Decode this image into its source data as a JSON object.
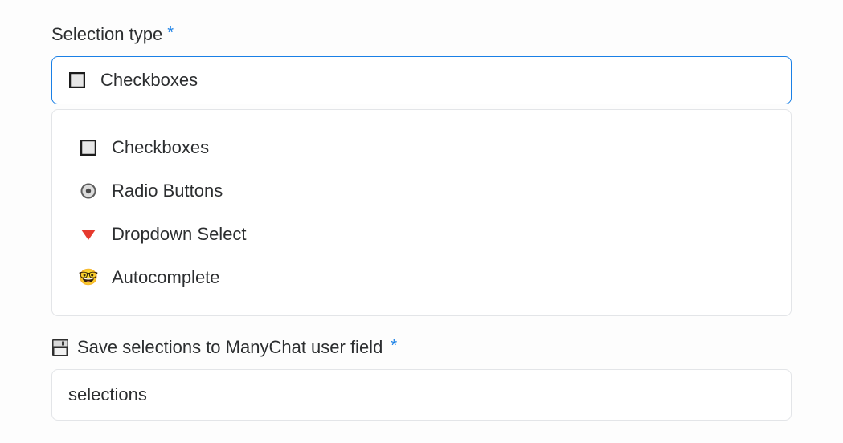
{
  "selection_type": {
    "label": "Selection type",
    "required_marker": "*",
    "selected": {
      "icon": "checkbox-icon",
      "text": "Checkboxes"
    },
    "options": [
      {
        "icon": "checkbox-icon",
        "text": "Checkboxes"
      },
      {
        "icon": "radio-icon",
        "text": "Radio Buttons"
      },
      {
        "icon": "dropdown-icon",
        "text": "Dropdown Select"
      },
      {
        "icon": "autocomplete-icon",
        "text": "Autocomplete"
      }
    ]
  },
  "save_field": {
    "icon": "save-icon",
    "label": "Save selections to ManyChat user field",
    "required_marker": "*",
    "value": "selections"
  }
}
